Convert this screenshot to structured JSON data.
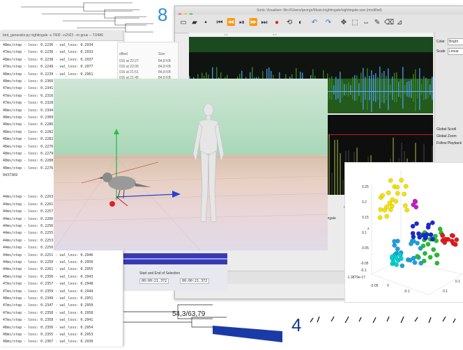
{
  "background": {
    "top_number": "8",
    "bottom_number": "4",
    "dendro_label": "54,3/63,79"
  },
  "terminal": {
    "title": "bird_generator.py nightingale -s 7600 --n2023 --m gnue -- 7/2480",
    "lines": [
      "48ms/step - loss: 0.2236 - val_loss: 0.2934",
      "47ms/step - loss: 0.2236 - val_loss: 0.2933",
      "48ms/step - loss: 0.2238 - val_loss: 0.2937",
      "47ms/step - loss: 0.2249 - val_loss: 0.2977",
      "48ms/step - loss: 0.2239 - val_loss: 0.2961",
      "48ms/step - loss: 0.2366 - val_loss: 0.3017",
      "47ms/step - loss: 0.2341 - val_loss: 0.2987",
      "47ms/step - loss: 0.2316 - val_loss: 0.2981",
      "47ms/step - loss: 0.2328 - val_loss: 0.2996",
      "48ms/step - loss: 0.2344 - val_loss: 0.2975",
      "48ms/step - loss: 0.2309 - val_loss: 0.2948",
      "48ms/step - loss: 0.2286 - val_loss: 0.2961",
      "48ms/step - loss: 0.2282 - val_loss: 0.2958",
      "48ms/step - loss: 0.2282 - val_loss: 0.2945",
      "48ms/step - loss: 0.2276 - val_loss: 0.2939",
      "48ms/step - loss: 0.2279 - val_loss: 0.2938",
      "48ms/step - loss: 0.2288 - val_loss: 0.2923",
      "48ms/step - loss: 0.2276 - val_loss: 0.2920",
      "0437369",
      "",
      "",
      "44ms/step - loss: 0.2263 - val_loss: 0.2926",
      "44ms/step - loss: 0.2261 - val_loss: 0.2933",
      "44ms/step - loss: 0.2257 - val_loss: 0.2930",
      "44ms/step - loss: 0.2266 - val_loss: 0.2934",
      "44ms/step - loss: 0.2256 - val_loss: 0.2948",
      "44ms/step - loss: 0.2255 - val_loss: 0.2953",
      "44ms/step - loss: 0.2253 - val_loss: 0.2950",
      "44ms/step - loss: 0.2250 - val_loss: 0.2956",
      "44ms/step - loss: 0.2251 - val_loss: 0.2946",
      "44ms/step - loss: 0.2250 - val_loss: 0.2950",
      "44ms/step - loss: 0.2261 - val_loss: 0.2955",
      "48ms/step - loss: 0.2356 - val_loss: 0.2943",
      "47ms/step - loss: 0.2357 - val_loss: 0.2948",
      "47ms/step - loss: 0.2359 - val_loss: 0.2944",
      "48ms/step - loss: 0.2349 - val_loss: 0.2951",
      "47ms/step - loss: 0.2347 - val_loss: 0.2950",
      "47ms/step - loss: 0.2358 - val_loss: 0.2958",
      "47ms/step - loss: 0.2358 - val_loss: 0.2941",
      "48ms/step - loss: 0.2356 - val_loss: 0.2954",
      "48ms/step - loss: 0.2355 - val_loss: 0.2953",
      "48ms/step - loss: 0.2367 - val_loss: 0.2939"
    ]
  },
  "finder": {
    "headers": [
      "dified",
      "Size"
    ],
    "rows": [
      [
        "016 at 22:27",
        "84,8 KB"
      ],
      [
        "016 at 22:06",
        "84,8 KB"
      ],
      [
        "016 at 21:51",
        "84,8 KB"
      ],
      [
        "016 at 21:45",
        "84,8 KB"
      ]
    ]
  },
  "sonic_visualiser": {
    "title": "Sonic Visualiser: file:///Users/george/Music/nightingale/nightingale.wav (modified)",
    "ruler_marks": [
      "1:4",
      "4:8"
    ],
    "side_panel": {
      "color_label": "Color",
      "color_value": "Bright",
      "scale_label": "Scale",
      "scale_value": "Linear",
      "global_scroll": "Global Scroll",
      "global_zoom": "Global Zoom",
      "follow_playback": "Follow Playback"
    },
    "selection_label": "Start and End of Selection",
    "time_start": "00:00:21.372",
    "time_end": "00:00:21.372",
    "mini_labels": [
      "modes",
      "tingale"
    ]
  },
  "scatter": {
    "axis_labels": [
      "-1.3879e-17",
      "0",
      "-0.05",
      "-0.1",
      "0.25",
      "0.2",
      "0.15",
      "0.1",
      "0.05",
      "-0.05",
      "-0.1",
      "z",
      "0.1",
      "0.1"
    ]
  },
  "colors": {
    "wave_green": "#3a8a2a",
    "wave_blue": "#4aa0e8",
    "accent_blue": "#2a8fd6"
  }
}
